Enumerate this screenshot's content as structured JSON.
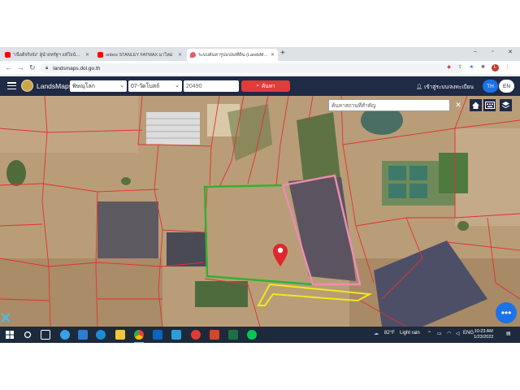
{
  "browser": {
    "tabs": [
      {
        "title": "\"เนื้อดีจริงจัง\" ผู้นำสหรัฐฯ แท้ใจนักการ",
        "favicon": "youtube-icon",
        "active": false
      },
      {
        "title": "unbox STANLEY FATMAX มาใหม่",
        "favicon": "youtube-icon",
        "active": false
      },
      {
        "title": "ระบบค้นหารูปแปลงที่ดิน (LandsMaps)",
        "favicon": "landsmaps-icon",
        "active": true
      }
    ],
    "new_tab": "+",
    "window_controls": {
      "minimize": "–",
      "maximize": "▫",
      "close": "✕"
    },
    "url": "landsmaps.dol.go.th",
    "profile_initial": "L"
  },
  "header": {
    "brand": "LandsMaps",
    "province": "พิษณุโลก",
    "district": "07-วัดโบสถ์",
    "parcel_number": "20490",
    "search_label": "ค้นหา",
    "login_label": "เข้าสู่ระบบ/ลงทะเบียน",
    "lang_th": "TH",
    "lang_en": "EN"
  },
  "map": {
    "search_placeholder": "ค้นหาสถานที่สำคัญ",
    "close_symbol": "✕",
    "colors": {
      "parcel_line": "#e03232",
      "selected_parcel": "#2fb22f",
      "neighbor_parcel": "#f08cb4",
      "road_highlight": "#f2e81c",
      "marker": "#e0262e"
    }
  },
  "taskbar": {
    "weather_temp": "82°F",
    "weather_text": "Light rain",
    "language": "ENG",
    "time": "10:23 AM",
    "date": "1/23/2022"
  },
  "colors": {
    "header_bg": "#1f2a44",
    "search_button": "#e23b3b",
    "active_lang": "#1a73e8"
  }
}
